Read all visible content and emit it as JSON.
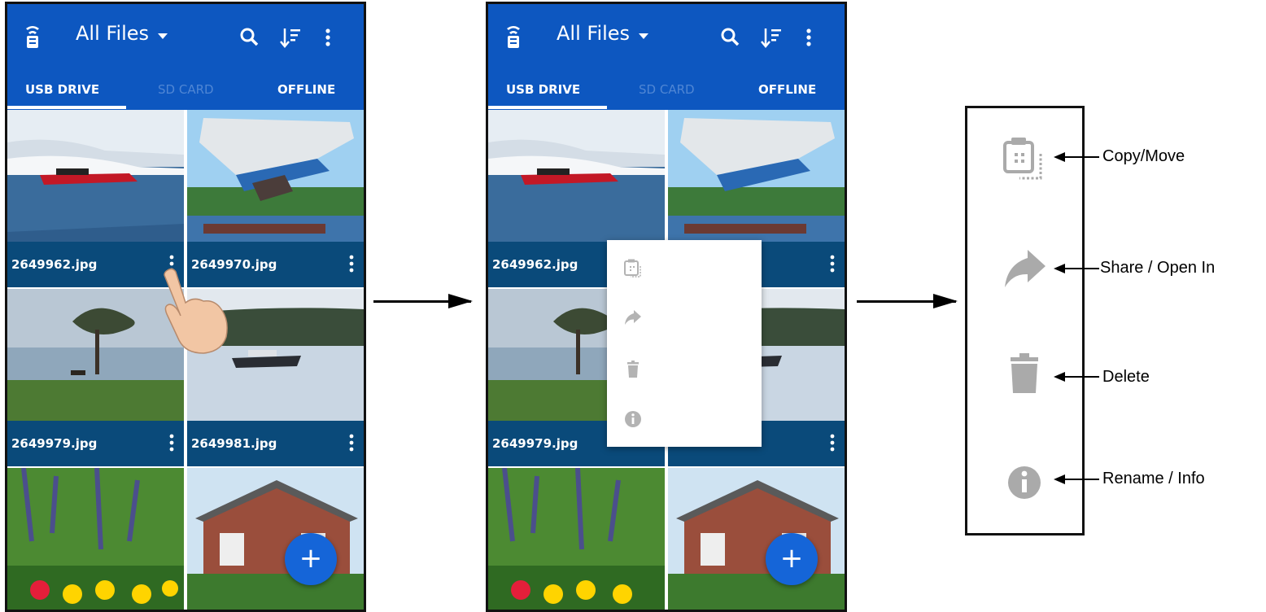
{
  "app": {
    "title": "All Files",
    "tabs": [
      "USB DRIVE",
      "SD CARD",
      "OFFLINE"
    ],
    "active_tab": "USB DRIVE",
    "accent_color": "#0d57c0",
    "caption_color": "#0a4a7a",
    "fab_label": "+"
  },
  "files": [
    {
      "name": "2649962.jpg"
    },
    {
      "name": "2649970.jpg"
    },
    {
      "name": "2649979.jpg"
    },
    {
      "name": "2649981.jpg"
    }
  ],
  "popup_menu": {
    "items": [
      "copy-move-icon",
      "share-icon",
      "delete-icon",
      "info-icon"
    ]
  },
  "legend": {
    "items": [
      {
        "icon": "copy-move-icon",
        "label": "Copy/Move"
      },
      {
        "icon": "share-icon",
        "label": "Share / Open In"
      },
      {
        "icon": "delete-icon",
        "label": "Delete"
      },
      {
        "icon": "info-icon",
        "label": "Rename / Info"
      }
    ]
  }
}
